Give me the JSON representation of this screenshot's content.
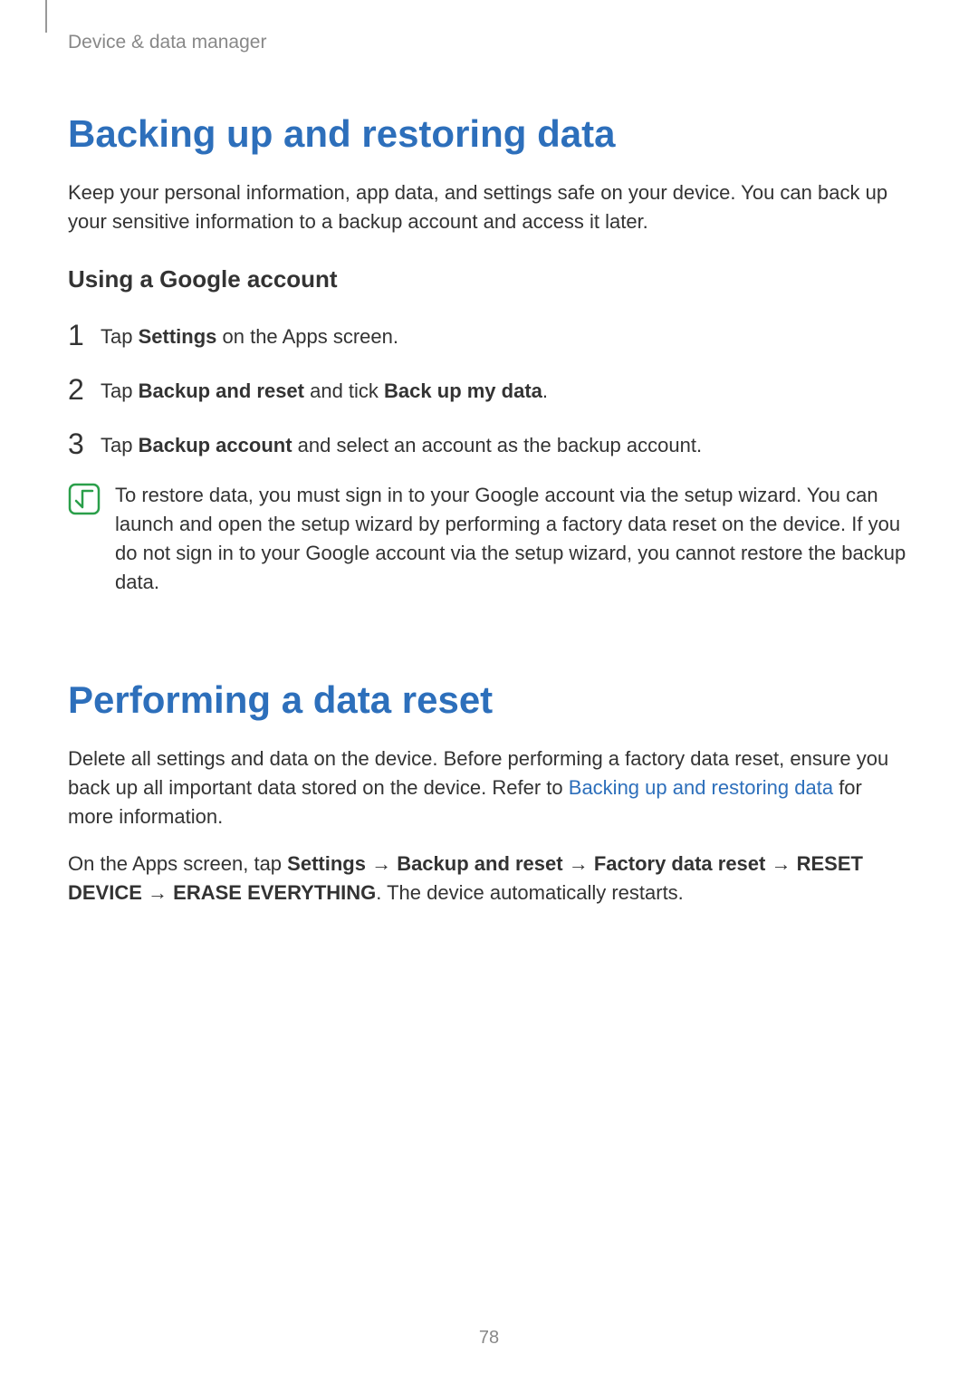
{
  "breadcrumb": "Device & data manager",
  "section1": {
    "title": "Backing up and restoring data",
    "intro": "Keep your personal information, app data, and settings safe on your device. You can back up your sensitive information to a backup account and access it later.",
    "subheading": "Using a Google account",
    "step1_prefix": "Tap ",
    "step1_bold": "Settings",
    "step1_suffix": " on the Apps screen.",
    "step2_prefix": "Tap ",
    "step2_bold1": "Backup and reset",
    "step2_mid": " and tick ",
    "step2_bold2": "Back up my data",
    "step2_suffix": ".",
    "step3_prefix": "Tap ",
    "step3_bold": "Backup account",
    "step3_suffix": " and select an account as the backup account.",
    "note": "To restore data, you must sign in to your Google account via the setup wizard. You can launch and open the setup wizard by performing a factory data reset on the device. If you do not sign in to your Google account via the setup wizard, you cannot restore the backup data."
  },
  "section2": {
    "title": "Performing a data reset",
    "p1_prefix": "Delete all settings and data on the device. Before performing a factory data reset, ensure you back up all important data stored on the device. Refer to ",
    "p1_link": "Backing up and restoring data",
    "p1_suffix": " for more information.",
    "p2_prefix": "On the Apps screen, tap ",
    "p2_bold1": "Settings",
    "p2_arrow": " → ",
    "p2_bold2": "Backup and reset",
    "p2_bold3": "Factory data reset",
    "p2_bold4": "RESET DEVICE",
    "p2_bold5": "ERASE EVERYTHING",
    "p2_suffix": ". The device automatically restarts."
  },
  "numbers": {
    "n1": "1",
    "n2": "2",
    "n3": "3"
  },
  "page_number": "78"
}
